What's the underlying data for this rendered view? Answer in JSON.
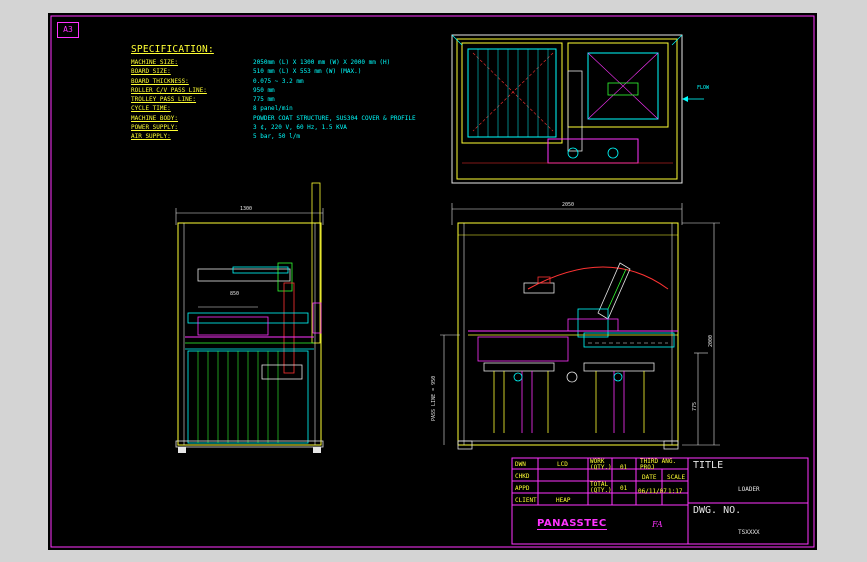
{
  "sheet": {
    "size_label": "A3"
  },
  "specification": {
    "title": "SPECIFICATION:",
    "rows": [
      {
        "label": "MACHINE SIZE:",
        "value": "2050mm (L) X 1300 mm (W) X 2000 mm (H)"
      },
      {
        "label": "BOARD SIZE:",
        "value": "510 mm (L) X 553 mm (W) (MAX.)"
      },
      {
        "label": "BOARD THICKNESS:",
        "value": "0.075 ~ 3.2 mm"
      },
      {
        "label": "ROLLER C/V PASS LINE:",
        "value": "950 mm"
      },
      {
        "label": "TROLLEY PASS LINE:",
        "value": "775 mm"
      },
      {
        "label": "CYCLE TIME:",
        "value": "8 panel/min"
      },
      {
        "label": "MACHINE BODY:",
        "value": "POWDER COAT STRUCTURE, SUS304 COVER & PROFILE"
      },
      {
        "label": "POWER SUPPLY:",
        "value": "3 ¢, 220 V, 60 Hz, 1.5 KVA"
      },
      {
        "label": "AIR SUPPLY:",
        "value": "5 bar, 50 l/m"
      }
    ]
  },
  "views": {
    "flow_label": "FLOW",
    "side_width_dim": "1300",
    "side_inner_dim": "850",
    "front_length_dim": "2050",
    "front_height_dim": "2000",
    "front_trolley_dim": "775",
    "pass_line_label": "PASS LINE = 950"
  },
  "title_block": {
    "dwn_label": "DWN",
    "dwn_value": "LCD",
    "chkd_label": "CHKD",
    "appd_label": "APPD",
    "client_label": "CLIENT",
    "client_value": "HEAP",
    "work_qty_label": "WORK (QTY.)",
    "work_qty_value": "01",
    "total_qty_label": "TOTAL (QTY.)",
    "total_qty_value": "01",
    "projection": "THIRD ANG. PROJ",
    "date_label": "DATE",
    "date_value": "06/11/07",
    "scale_label": "SCALE",
    "scale_value": "1:17",
    "title_label": "TITLE",
    "title_value": "LOADER",
    "dwg_no_label": "DWG. NO.",
    "dwg_no_value": "TSXXXX",
    "logo_text": "PANASSTEC",
    "logo_suffix": "FA"
  },
  "colors": {
    "frame": "#ff33ff",
    "spec_label": "#ffff33",
    "spec_value": "#00ffff",
    "structure": "#ffff33",
    "machine": "#00ffff",
    "accent_red": "#ff3333",
    "accent_green": "#33ff33",
    "dimension": "#e6e6e6"
  }
}
